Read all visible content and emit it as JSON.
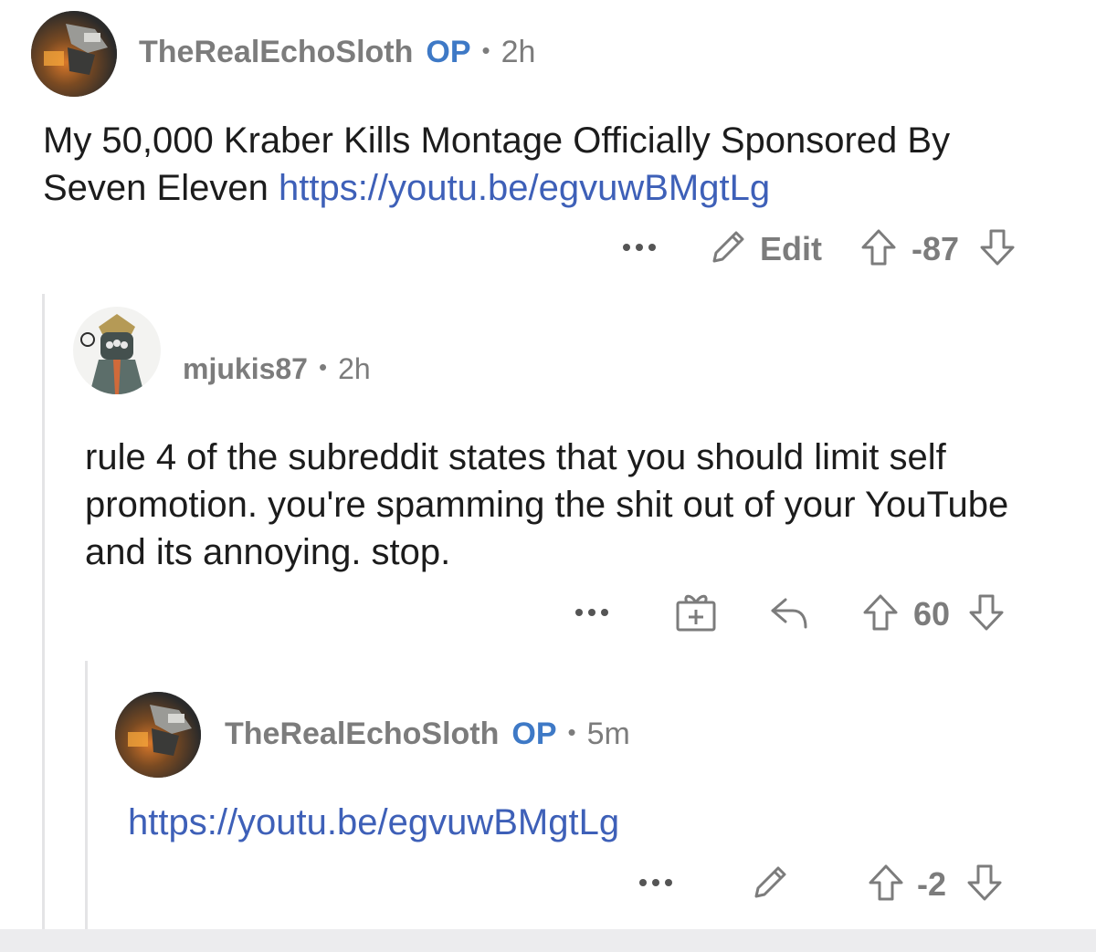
{
  "post_comment": {
    "author": "TheRealEchoSloth",
    "op_badge": "OP",
    "separator": "•",
    "time": "2h",
    "text": "My 50,000 Kraber Kills Montage Officially Sponsored By Seven Eleven",
    "link": "https://youtu.be/egvuwBMgtLg",
    "more": "•••",
    "edit_label": "Edit",
    "score": "-87"
  },
  "reply_1": {
    "author": "mjukis87",
    "separator": "•",
    "time": "2h",
    "text": "rule 4 of the subreddit states that you should limit self promotion. you're spamming the shit out of your YouTube and its annoying. stop.",
    "more": "•••",
    "score": "60"
  },
  "reply_2": {
    "author": "TheRealEchoSloth",
    "op_badge": "OP",
    "separator": "•",
    "time": "5m",
    "link": "https://youtu.be/egvuwBMgtLg",
    "more": "•••",
    "score": "-2"
  },
  "colors": {
    "op_blue": "#3e79c6",
    "link_blue": "#3e60b8",
    "meta_gray": "#7c7c7c",
    "thread_line": "#e4e4e6"
  },
  "icons": [
    "pencil-icon",
    "upvote-icon",
    "downvote-icon",
    "gift-icon",
    "reply-icon",
    "more-icon"
  ]
}
